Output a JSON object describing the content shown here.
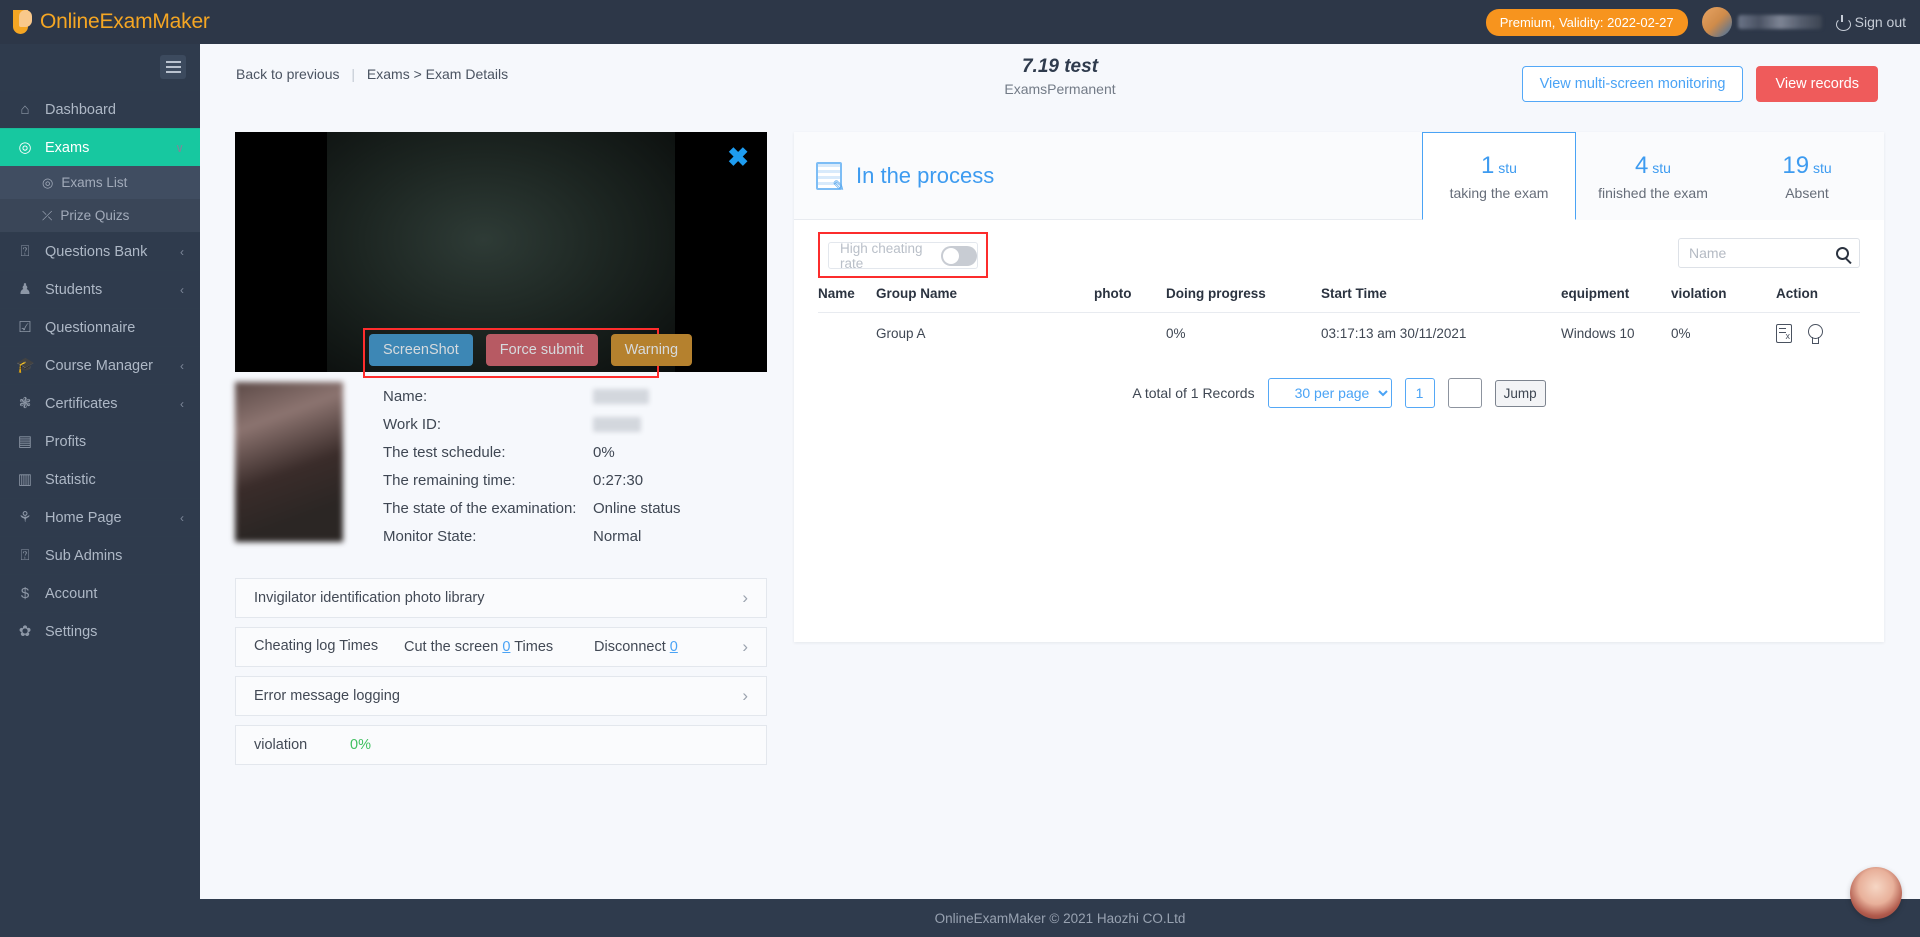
{
  "topbar": {
    "brand": "OnlineExamMaker",
    "premium_badge": "Premium, Validity: 2022-02-27",
    "signout": "Sign out"
  },
  "sidebar": {
    "items": [
      {
        "label": "Dashboard",
        "icon": "home-icon",
        "caret": ""
      },
      {
        "label": "Exams",
        "icon": "check-circle-icon",
        "caret": "∨"
      },
      {
        "label": "Questions Bank",
        "icon": "question-circle-icon",
        "caret": "‹"
      },
      {
        "label": "Students",
        "icon": "user-icon",
        "caret": "‹"
      },
      {
        "label": "Questionnaire",
        "icon": "checkbox-icon",
        "caret": ""
      },
      {
        "label": "Course Manager",
        "icon": "graduation-cap-icon",
        "caret": "‹"
      },
      {
        "label": "Certificates",
        "icon": "badge-icon",
        "caret": "‹"
      },
      {
        "label": "Profits",
        "icon": "card-icon",
        "caret": ""
      },
      {
        "label": "Statistic",
        "icon": "bar-chart-icon",
        "caret": ""
      },
      {
        "label": "Home Page",
        "icon": "sprout-icon",
        "caret": "‹"
      },
      {
        "label": "Sub Admins",
        "icon": "question-circle-icon",
        "caret": ""
      },
      {
        "label": "Account",
        "icon": "dollar-icon",
        "caret": ""
      },
      {
        "label": "Settings",
        "icon": "gear-icon",
        "caret": ""
      }
    ],
    "subitems": [
      {
        "label": "Exams List",
        "icon": "check-circle-icon"
      },
      {
        "label": "Prize Quizs",
        "icon": "shuffle-icon"
      }
    ]
  },
  "header": {
    "back": "Back to previous",
    "breadcrumb": "Exams > Exam Details",
    "exam_title": "7.19 test",
    "exam_subtitle": "ExamsPermanent",
    "btn_monitoring": "View multi-screen monitoring",
    "btn_records": "View records"
  },
  "monitor": {
    "video_buttons": [
      {
        "label": "ScreenShot",
        "color": "#3d87b5"
      },
      {
        "label": "Force submit",
        "color": "#b75a63"
      },
      {
        "label": "Warning",
        "color": "#b5812e"
      }
    ],
    "details": [
      {
        "label": "Name:",
        "value": "",
        "blur": true
      },
      {
        "label": "Work ID:",
        "value": "",
        "blur": true
      },
      {
        "label": "The test schedule:",
        "value": "0%"
      },
      {
        "label": "The remaining time:",
        "value": "0:27:30"
      },
      {
        "label": "The state of the examination:",
        "value": "Online status"
      },
      {
        "label": "Monitor State:",
        "value": "Normal"
      }
    ],
    "accordion": {
      "photo_library": "Invigilator identification photo library",
      "cheating_log_label": "Cheating log Times",
      "cut_screen_prefix": "Cut the screen",
      "cut_screen_count": "0",
      "cut_screen_suffix": "Times",
      "disconnect_label": "Disconnect",
      "disconnect_count": "0",
      "error_log": "Error message logging",
      "violation_label": "violation",
      "violation_value": "0%"
    }
  },
  "statusbar": {
    "process_label": "In the process",
    "tabs": [
      {
        "count": "1",
        "unit": "stu",
        "label": "taking the exam",
        "active": true
      },
      {
        "count": "4",
        "unit": "stu",
        "label": "finished the exam",
        "active": false
      },
      {
        "count": "19",
        "unit": "stu",
        "label": "Absent",
        "active": false
      }
    ]
  },
  "filters": {
    "cheat_toggle_label": "High cheating rate",
    "cheat_toggle_on": false,
    "search_placeholder": "Name",
    "search_value": ""
  },
  "table": {
    "columns": [
      "Name",
      "Group Name",
      "photo",
      "Doing progress",
      "Start Time",
      "equipment",
      "violation",
      "Action"
    ],
    "rows": [
      {
        "name": "",
        "group": "Group A",
        "progress": "0%",
        "start_time": "03:17:13 am 30/11/2021",
        "equipment": "Windows 10",
        "violation": "0%"
      }
    ]
  },
  "pagination": {
    "total_text": "A total of 1 Records",
    "per_page": "30 per page",
    "current_page": "1",
    "jump_value": "",
    "jump_label": "Jump"
  },
  "footer": {
    "text": "OnlineExamMaker © 2021 Haozhi CO.Ltd"
  },
  "colors": {
    "accent_blue": "#4aa3f5",
    "brand_orange": "#f5a623",
    "active_green": "#17c8a0",
    "danger_red": "#ef5b5b",
    "highlight_red": "#fc2c2c",
    "success_green": "#3fbf5f"
  }
}
